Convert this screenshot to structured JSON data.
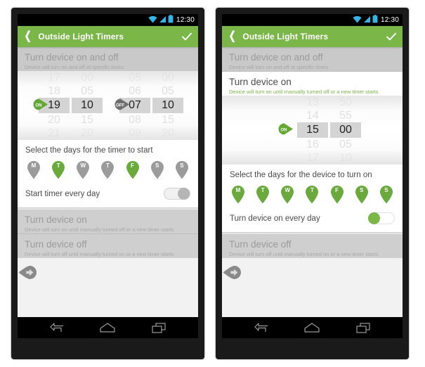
{
  "status_bar": {
    "time": "12:30",
    "icons": [
      "wifi-icon",
      "signal-icon",
      "battery-icon"
    ],
    "icon_color": "#33b5e5",
    "background": "#000000"
  },
  "app_bar": {
    "title": "Outside Light Timers",
    "back_icon": "back-chevron-icon",
    "confirm_icon": "check-icon",
    "background": "#7ab648"
  },
  "colors": {
    "green": "#7ab648",
    "pink": "#e0579b",
    "gray_badge": "#7a7a7a",
    "dim_row": "#c9c9c9",
    "text_dark": "#4a4a4a",
    "text_dim": "#9b9b9b"
  },
  "screen_left": {
    "rows": {
      "on_and_off": {
        "title": "Turn device on and off",
        "subtitle": "Device will turn on and off at specific times",
        "badge": "pink-down-arrow-pin-icon",
        "state": "expanded"
      },
      "turn_on": {
        "title": "Turn device on",
        "subtitle": "Device will turn on until manually turned off or a new timer starts",
        "badge": "gray-right-arrow-pin-icon",
        "state": "collapsed"
      },
      "turn_off": {
        "title": "Turn device off",
        "subtitle": "Device will turn off until manually turned on or a new timer starts",
        "badge": "gray-right-arrow-pin-icon",
        "state": "collapsed"
      }
    },
    "picker": {
      "on_badge": "ON",
      "off_badge": "OFF",
      "on_hours": [
        "17",
        "18",
        "19",
        "20",
        "21"
      ],
      "on_minutes": [
        "00",
        "05",
        "10",
        "15",
        "20"
      ],
      "off_hours": [
        "05",
        "06",
        "07",
        "08",
        "09"
      ],
      "off_minutes": [
        "00",
        "05",
        "10",
        "15",
        "20"
      ],
      "selected_on_hour": "19",
      "selected_on_minute": "10",
      "selected_off_hour": "07",
      "selected_off_minute": "10"
    },
    "days_section": {
      "title": "Select the days for the timer to start",
      "days": [
        {
          "label": "M",
          "selected": false
        },
        {
          "label": "T",
          "selected": true
        },
        {
          "label": "W",
          "selected": false
        },
        {
          "label": "T",
          "selected": false
        },
        {
          "label": "F",
          "selected": true
        },
        {
          "label": "S",
          "selected": false
        },
        {
          "label": "S",
          "selected": false
        }
      ],
      "every_day_label": "Start timer every day",
      "every_day_on": false
    }
  },
  "screen_right": {
    "rows": {
      "on_and_off": {
        "title": "Turn device on and off",
        "subtitle": "Device will turn on and off at specific times",
        "badge": "gray-right-arrow-pin-icon",
        "state": "collapsed"
      },
      "turn_on": {
        "title": "Turn device on",
        "subtitle": "Device will turn on until manually turned off or a new timer starts",
        "badge": "pink-down-arrow-pin-icon",
        "state": "expanded"
      },
      "turn_off": {
        "title": "Turn device off",
        "subtitle": "Device will turn off until manually turned on or a new timer starts",
        "badge": "gray-right-arrow-pin-icon",
        "state": "collapsed"
      }
    },
    "picker": {
      "on_badge": "ON",
      "hours": [
        "13",
        "14",
        "15",
        "16",
        "17"
      ],
      "minutes": [
        "50",
        "55",
        "00",
        "05",
        "10"
      ],
      "selected_hour": "15",
      "selected_minute": "00"
    },
    "days_section": {
      "title": "Select the days for the device to turn on",
      "days": [
        {
          "label": "M",
          "selected": true
        },
        {
          "label": "T",
          "selected": true
        },
        {
          "label": "W",
          "selected": true
        },
        {
          "label": "T",
          "selected": true
        },
        {
          "label": "F",
          "selected": true
        },
        {
          "label": "S",
          "selected": true
        },
        {
          "label": "S",
          "selected": true
        }
      ],
      "every_day_label": "Turn device on every day",
      "every_day_on": true
    }
  },
  "nav_bar": {
    "back_icon": "back-arrow-icon",
    "home_icon": "home-icon",
    "recents_icon": "recents-icon"
  }
}
